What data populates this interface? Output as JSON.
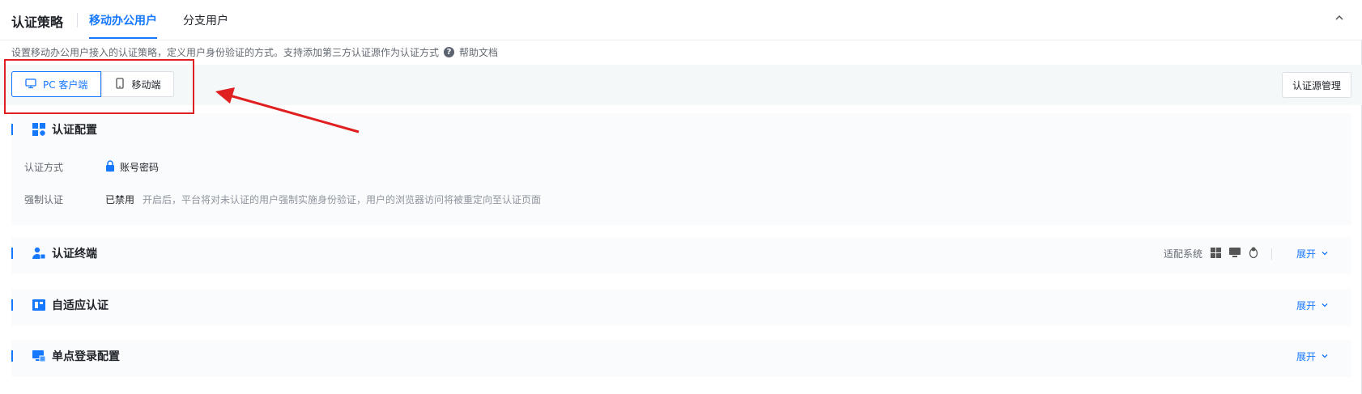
{
  "header": {
    "title": "认证策略",
    "tabs": [
      {
        "label": "移动办公用户",
        "active": true
      },
      {
        "label": "分支用户",
        "active": false
      }
    ]
  },
  "description": {
    "text": "设置移动办公用户接入的认证策略，定义用户身份验证的方式。支持添加第三方认证源作为认证方式",
    "help_link": "帮助文档"
  },
  "toolbar": {
    "segments": [
      {
        "label": "PC 客户端",
        "icon": "desktop-icon",
        "active": true
      },
      {
        "label": "移动端",
        "icon": "mobile-icon",
        "active": false
      }
    ],
    "auth_source_button": "认证源管理"
  },
  "sections": {
    "auth_config": {
      "title": "认证配置",
      "rows": [
        {
          "label": "认证方式",
          "value": "账号密码",
          "icon": "lock-icon"
        },
        {
          "label": "强制认证",
          "value": "已禁用",
          "hint": "开启后，平台将对未认证的用户强制实施身份验证，用户的浏览器访问将被重定向至认证页面"
        }
      ]
    },
    "auth_terminal": {
      "title": "认证终端",
      "systems_label": "适配系统",
      "systems": [
        "windows-icon",
        "macos-icon",
        "linux-icon"
      ],
      "expand": "展开"
    },
    "adaptive_auth": {
      "title": "自适应认证",
      "expand": "展开"
    },
    "sso_config": {
      "title": "单点登录配置",
      "expand": "展开"
    }
  },
  "colors": {
    "accent": "#1677ff",
    "annotation": "#e02020"
  }
}
